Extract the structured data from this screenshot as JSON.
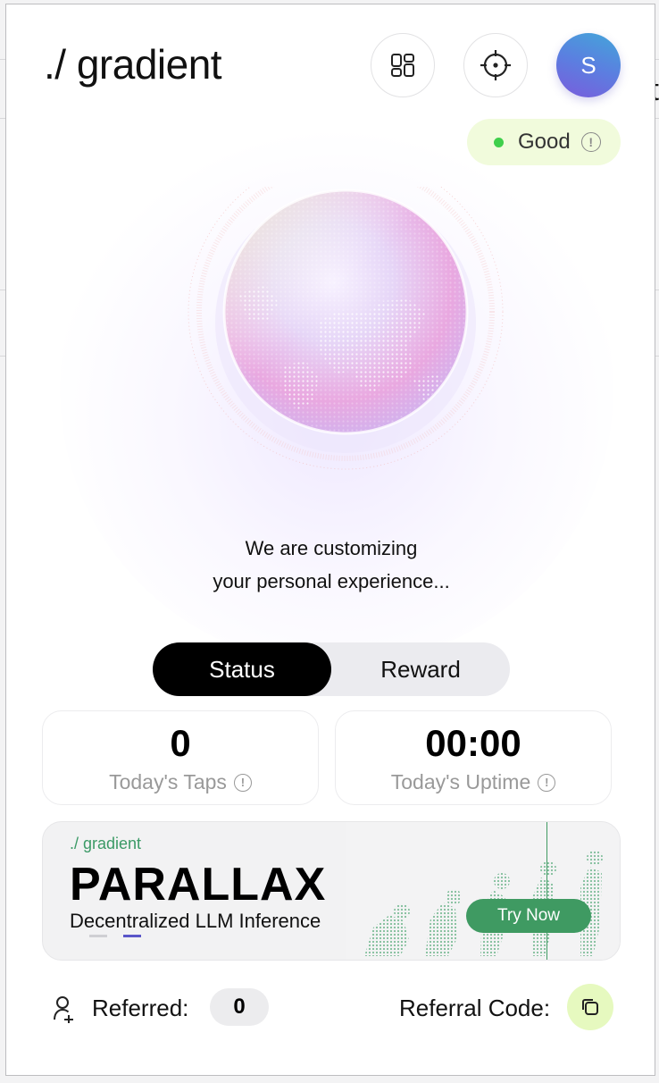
{
  "app": {
    "logo": "./ gradient",
    "avatar_letter": "S"
  },
  "header": {
    "icons": [
      "dashboard-icon",
      "crosshair-icon"
    ],
    "status": {
      "label": "Good",
      "dot_color": "#3fcf4b",
      "info_glyph": "!"
    }
  },
  "hero": {
    "line1": "We are customizing",
    "line2": "your personal experience..."
  },
  "tabs": [
    {
      "label": "Status",
      "active": true
    },
    {
      "label": "Reward",
      "active": false
    }
  ],
  "stats": {
    "taps": {
      "value": "0",
      "label": "Today's Taps"
    },
    "uptime": {
      "value": "00:00",
      "label": "Today's Uptime"
    },
    "info_glyph": "!"
  },
  "banner": {
    "brand": "./ gradient",
    "title": "PARALLAX",
    "subtitle": "Decentralized LLM Inference",
    "cta": "Try Now",
    "accent": "#3f9a62"
  },
  "footer": {
    "referred_label": "Referred:",
    "referred_count": "0",
    "referral_code_label": "Referral Code:"
  },
  "background_page": {
    "edge_char": "t"
  }
}
